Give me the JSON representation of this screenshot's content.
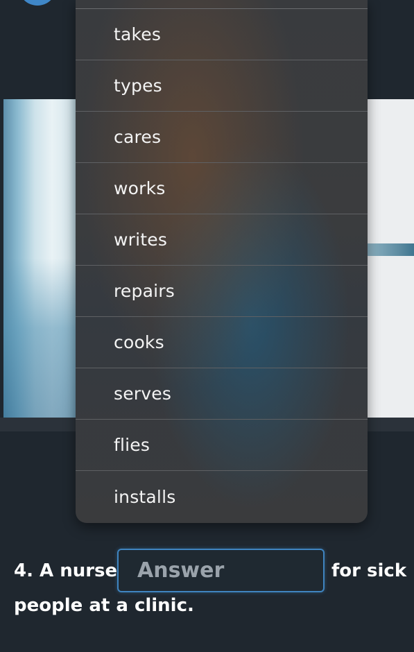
{
  "dropdown": {
    "options": [
      "takes",
      "types",
      "cares",
      "works",
      "writes",
      "repairs",
      "cooks",
      "serves",
      "flies",
      "installs"
    ]
  },
  "question": {
    "prefix": "4. A nurse",
    "answer_placeholder": "Answer",
    "suffix": "for sick",
    "line2": "people at a clinic."
  },
  "colors": {
    "background": "#1f272f",
    "answer_border": "#3f84c0",
    "avatar": "#3f87c8"
  }
}
